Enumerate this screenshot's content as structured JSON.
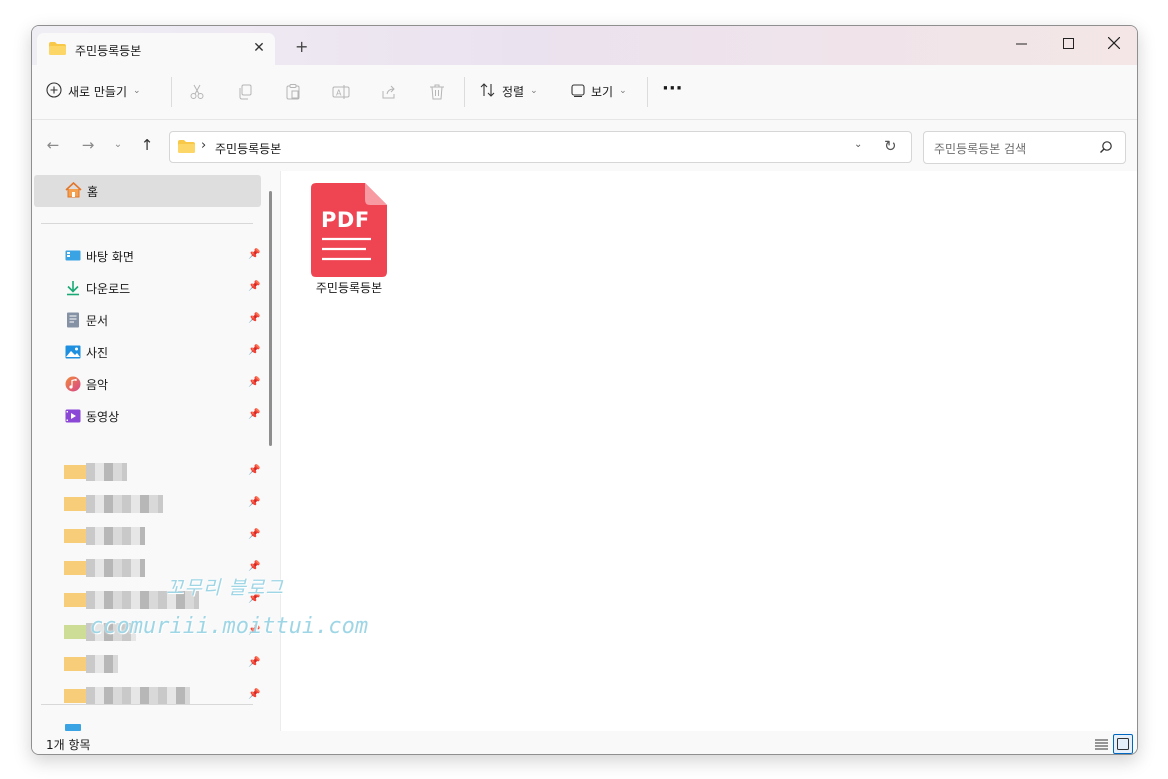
{
  "window": {
    "tab_title": "주민등록등본"
  },
  "toolbar": {
    "new_label": "새로 만들기",
    "sort_label": "정렬",
    "view_label": "보기",
    "more_label": "···"
  },
  "address": {
    "separator": "›",
    "path": "주민등록등본",
    "search_placeholder": "주민등록등본 검색"
  },
  "sidebar": {
    "home": "홈",
    "items": [
      {
        "label": "바탕 화면",
        "icon": "desktop-icon"
      },
      {
        "label": "다운로드",
        "icon": "download-icon"
      },
      {
        "label": "문서",
        "icon": "document-icon"
      },
      {
        "label": "사진",
        "icon": "pictures-icon"
      },
      {
        "label": "음악",
        "icon": "music-icon"
      },
      {
        "label": "동영상",
        "icon": "video-icon"
      }
    ]
  },
  "content": {
    "file": {
      "type_label": "PDF",
      "name": "주민등록등본"
    }
  },
  "status": {
    "item_count": "1개 항목"
  },
  "watermark": {
    "line1": "꼬무리 블로그",
    "line2": "ccomuriii.moittui.com"
  },
  "colors": {
    "pdf_red": "#ef4452",
    "folder_yellow": "#f8c948",
    "accent_blue": "#0067c0"
  }
}
